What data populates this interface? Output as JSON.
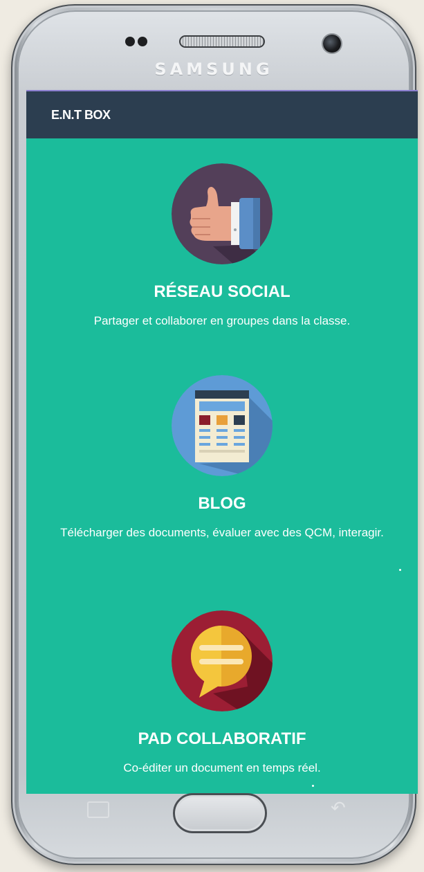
{
  "device": {
    "brand": "SAMSUNG"
  },
  "app": {
    "title": "E.N.T BOX",
    "colors": {
      "appbar": "#2c3e50",
      "background": "#1bbc9b",
      "text": "#ffffff"
    }
  },
  "features": [
    {
      "icon": "thumbs-up-icon",
      "title": "RÉSEAU SOCIAL",
      "description": "Partager et collaborer en groupes dans la classe."
    },
    {
      "icon": "blog-document-icon",
      "title": "BLOG",
      "description": "Télécharger des documents, évaluer avec des QCM, interagir."
    },
    {
      "icon": "chat-bubble-icon",
      "title": "PAD COLLABORATIF",
      "description": "Co-éditer un document en temps réel."
    }
  ],
  "navigation": {
    "buttons": [
      "recent-apps-icon",
      "home-button",
      "back-icon"
    ]
  }
}
